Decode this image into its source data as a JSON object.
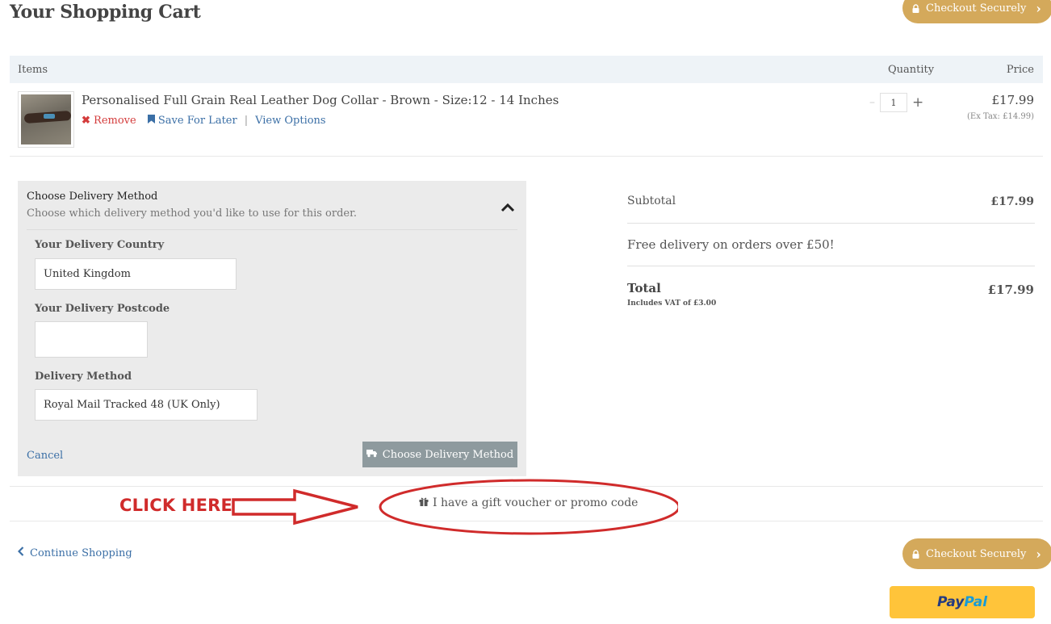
{
  "page_title": "Your Shopping Cart",
  "checkout_button": {
    "label": "Checkout Securely"
  },
  "table_header": {
    "items": "Items",
    "quantity": "Quantity",
    "price": "Price"
  },
  "cart_item": {
    "title": "Personalised Full Grain Real Leather Dog Collar - Brown - Size:12 - 14 Inches",
    "remove_label": "Remove",
    "save_label": "Save For Later",
    "separator": "|",
    "options_label": "View Options",
    "qty_minus": "–",
    "quantity": "1",
    "qty_plus": "+",
    "price": "£17.99",
    "price_ex_tax": "(Ex Tax: £14.99)"
  },
  "delivery": {
    "title": "Choose Delivery Method",
    "subtitle": "Choose which delivery method you'd like to use for this order.",
    "country_label": "Your Delivery Country",
    "country_value": "United Kingdom",
    "postcode_label": "Your Delivery Postcode",
    "postcode_value": "",
    "method_label": "Delivery Method",
    "method_value": "Royal Mail Tracked 48 (UK Only)",
    "cancel_label": "Cancel",
    "choose_button_label": "Choose Delivery Method"
  },
  "summary": {
    "subtotal_label": "Subtotal",
    "subtotal_value": "£17.99",
    "free_delivery_note": "Free delivery on orders over £50!",
    "total_label": "Total",
    "total_value": "£17.99",
    "vat_note": "Includes VAT of £3.00"
  },
  "promo": {
    "label": "I have a gift voucher or promo code"
  },
  "annotation": {
    "click_here": "CLICK HERE",
    "color": "#d02b2b"
  },
  "continue_shopping": "Continue Shopping",
  "paypal": {
    "part1": "Pay",
    "part2": "Pal"
  },
  "colors": {
    "accent_gold": "#d4a95b",
    "link_blue": "#3b6fa6",
    "remove_red": "#d43c3c",
    "paypal_yellow": "#ffc43a"
  }
}
